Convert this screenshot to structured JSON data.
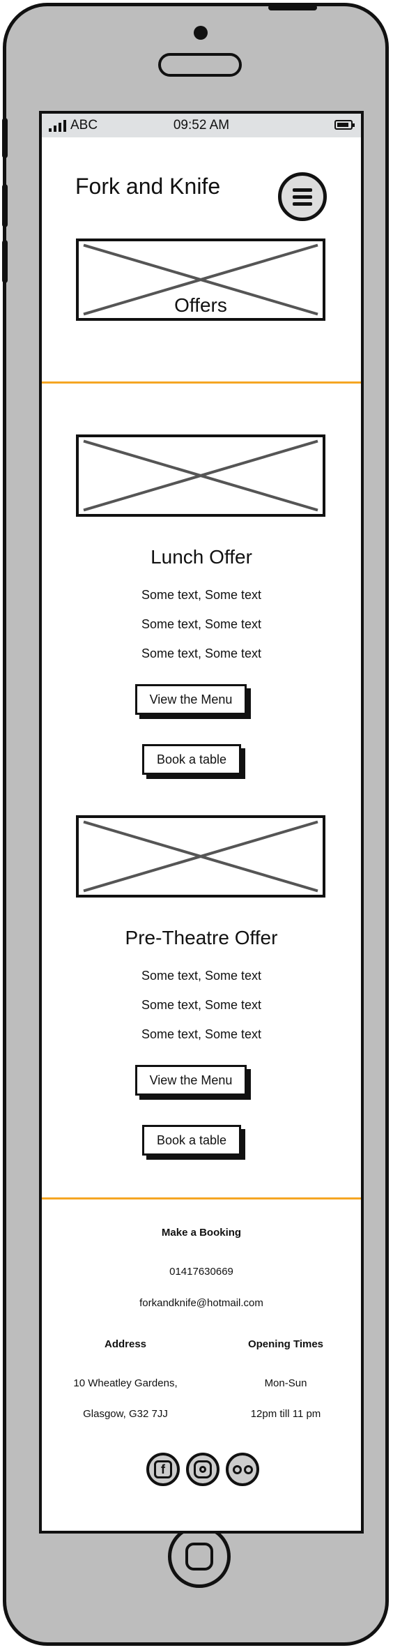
{
  "statusbar": {
    "carrier": "ABC",
    "time": "09:52 AM"
  },
  "header": {
    "title": "Fork and Knife"
  },
  "hero": {
    "label": "Offers"
  },
  "offers": [
    {
      "title": "Lunch Offer",
      "lines": [
        "Some text, Some text",
        "Some text, Some text",
        "Some text, Some text"
      ],
      "menu_button": "View the Menu",
      "book_button": "Book a table"
    },
    {
      "title": "Pre-Theatre Offer",
      "lines": [
        "Some text, Some text",
        "Some text, Some text",
        "Some text, Some text"
      ],
      "menu_button": "View the Menu",
      "book_button": "Book a table"
    }
  ],
  "footer": {
    "booking_heading": "Make a Booking",
    "phone": "01417630669",
    "email": "forkandknife@hotmail.com",
    "address_heading": "Address",
    "address_line1": "10 Wheatley Gardens,",
    "address_line2": "Glasgow, G32 7JJ",
    "hours_heading": "Opening Times",
    "hours_days": "Mon-Sun",
    "hours_time": "12pm till 11 pm",
    "social": [
      "facebook-icon",
      "instagram-icon",
      "tripadvisor-icon"
    ]
  },
  "colors": {
    "divider": "#f5a623",
    "frame": "#bdbdbd",
    "statusbar": "#dfe1e3"
  }
}
